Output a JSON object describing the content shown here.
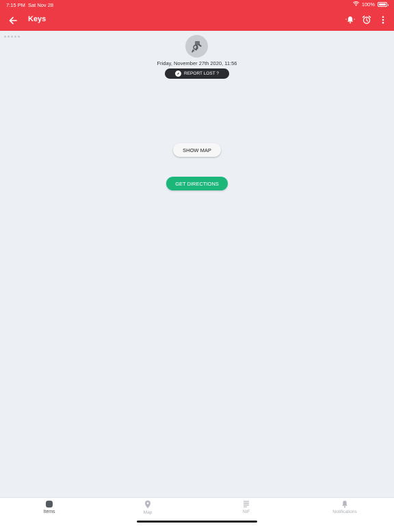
{
  "status": {
    "time": "7:15 PM",
    "date": "Sat Nov 28",
    "battery": "100%"
  },
  "header": {
    "title": "Keys"
  },
  "item": {
    "datetime": "Friday, November 27th 2020, 11:56",
    "report_label": "REPORT LOST ?"
  },
  "buttons": {
    "show_map": "SHOW MAP",
    "get_directions": "GET DIRECTIONS"
  },
  "tabs": [
    {
      "label": "Items",
      "icon": "items-icon",
      "active": true
    },
    {
      "label": "Map",
      "icon": "map-pin-icon",
      "active": false
    },
    {
      "label": "NtF",
      "icon": "list-icon",
      "active": false
    },
    {
      "label": "Notifications",
      "icon": "bell-icon",
      "active": false
    }
  ],
  "colors": {
    "header": "#ee3a44",
    "directions": "#1cb67b",
    "report": "#2b2c30",
    "background": "#ecf0f5"
  }
}
